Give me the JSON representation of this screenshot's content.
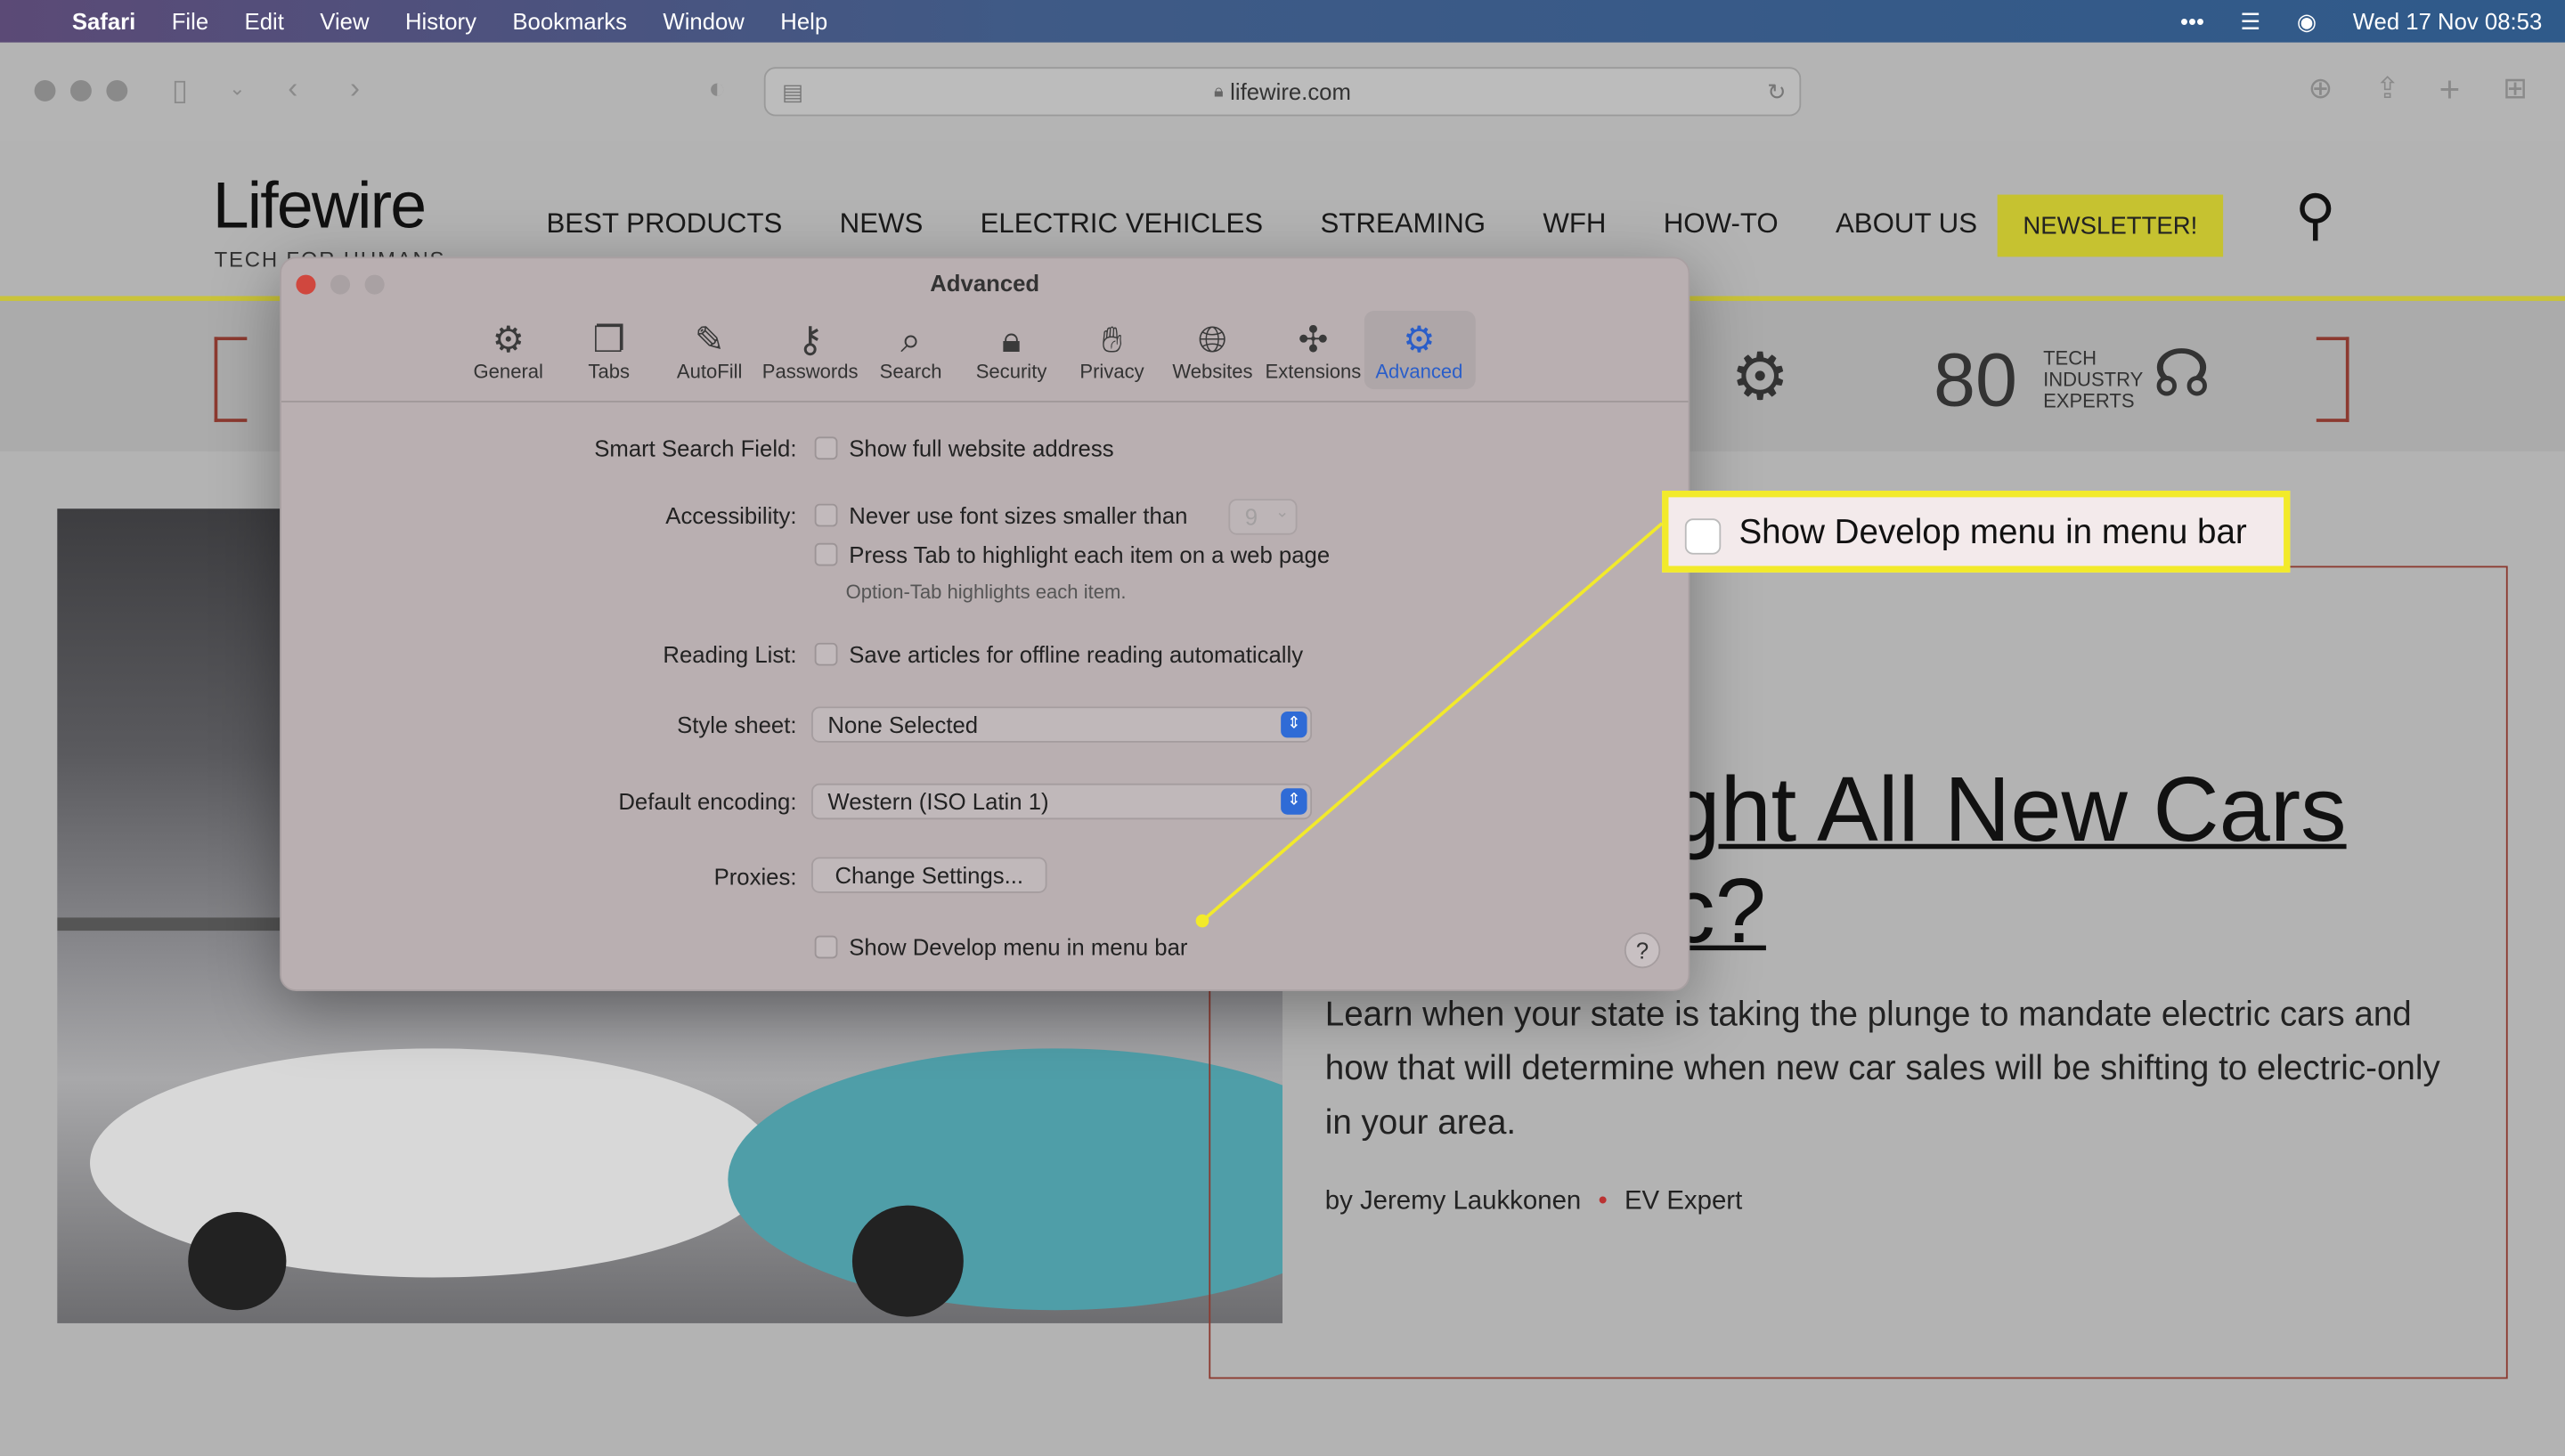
{
  "menubar": {
    "app": "Safari",
    "items": [
      "File",
      "Edit",
      "View",
      "History",
      "Bookmarks",
      "Window",
      "Help"
    ],
    "clock": "Wed 17 Nov  08:53"
  },
  "browser": {
    "url": "lifewire.com"
  },
  "site": {
    "logo": "Lifewire",
    "tagline": "TECH FOR HUMANS",
    "nav": [
      "BEST PRODUCTS",
      "NEWS",
      "ELECTRIC VEHICLES",
      "STREAMING",
      "WFH",
      "HOW-TO",
      "ABOUT US"
    ],
    "newsletter": "NEWSLETTER!",
    "stat": {
      "number": "80",
      "label": [
        "TECH",
        "INDUSTRY",
        "EXPERTS"
      ]
    },
    "headline_line1": "ight All New Cars",
    "headline_line2": "ic?",
    "summary": "Learn when your state is taking the plunge to mandate electric cars and how that will determine when new car sales will be shifting to electric-only in your area.",
    "author": "by Jeremy Laukkonen",
    "author_role": "EV Expert",
    "accent_color": "#c6c230"
  },
  "dialog": {
    "title": "Advanced",
    "tabs": [
      {
        "label": "General",
        "icon": "⚙"
      },
      {
        "label": "Tabs",
        "icon": "❐"
      },
      {
        "label": "AutoFill",
        "icon": "✎"
      },
      {
        "label": "Passwords",
        "icon": "⚷"
      },
      {
        "label": "Search",
        "icon": "⌕"
      },
      {
        "label": "Security",
        "icon": "🔒︎"
      },
      {
        "label": "Privacy",
        "icon": "✋︎"
      },
      {
        "label": "Websites",
        "icon": "🌐︎"
      },
      {
        "label": "Extensions",
        "icon": "✣"
      },
      {
        "label": "Advanced",
        "icon": "⚙"
      }
    ],
    "active_tab": "Advanced",
    "smart_search_label": "Smart Search Field:",
    "smart_search_opt": "Show full website address",
    "accessibility_label": "Accessibility:",
    "font_opt": "Never use font sizes smaller than",
    "font_size": "9",
    "tab_opt": "Press Tab to highlight each item on a web page",
    "tab_hint": "Option-Tab highlights each item.",
    "reading_label": "Reading List:",
    "reading_opt": "Save articles for offline reading automatically",
    "style_label": "Style sheet:",
    "style_value": "None Selected",
    "encoding_label": "Default encoding:",
    "encoding_value": "Western (ISO Latin 1)",
    "proxies_label": "Proxies:",
    "proxies_button": "Change Settings...",
    "develop_opt": "Show Develop menu in menu bar",
    "help": "?"
  },
  "callout": {
    "text": "Show Develop menu in menu bar",
    "border_color": "#f2ea2a"
  }
}
